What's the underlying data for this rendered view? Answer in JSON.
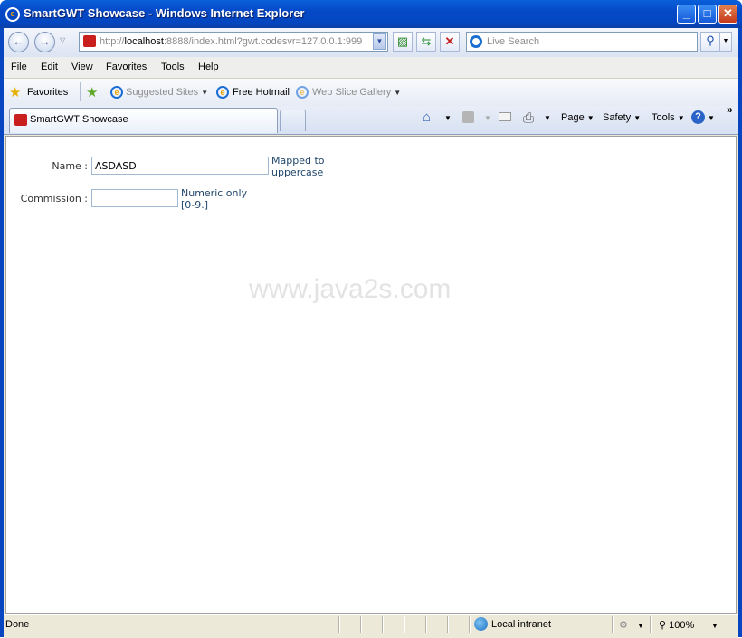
{
  "window": {
    "title": "SmartGWT Showcase - Windows Internet Explorer",
    "minimize_icon": "minimize-icon",
    "maximize_icon": "maximize-icon",
    "close_icon": "close-icon"
  },
  "navigation": {
    "address_prefix": "http://",
    "address_host": "localhost",
    "address_rest": ":8888/index.html?gwt.codesvr=127.0.0.1:999",
    "search_placeholder": "Live Search"
  },
  "menu": [
    "File",
    "Edit",
    "View",
    "Favorites",
    "Tools",
    "Help"
  ],
  "favorites_bar": {
    "favorites_label": "Favorites",
    "suggested_sites": "Suggested Sites",
    "free_hotmail": "Free Hotmail",
    "web_slice_gallery": "Web Slice Gallery"
  },
  "tab": {
    "title": "SmartGWT Showcase"
  },
  "command_bar": {
    "page": "Page",
    "safety": "Safety",
    "tools": "Tools",
    "overflow": "»"
  },
  "form": {
    "name_label": "Name :",
    "name_value": "ASDASD",
    "name_hint_line1": "Mapped to",
    "name_hint_line2": "uppercase",
    "commission_label": "Commission :",
    "commission_value": "",
    "commission_hint_line1": "Numeric only",
    "commission_hint_line2": "[0-9.]"
  },
  "watermark": "www.java2s.com",
  "status": {
    "text": "Done",
    "zone": "Local intranet",
    "zoom": "100%"
  }
}
